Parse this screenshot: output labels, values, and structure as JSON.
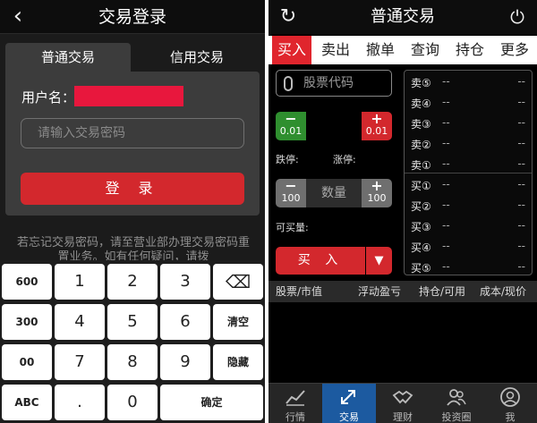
{
  "login_screen": {
    "title": "交易登录",
    "tabs": [
      {
        "label": "普通交易",
        "active": true
      },
      {
        "label": "信用交易",
        "active": false
      }
    ],
    "username_label": "用户名：",
    "password_placeholder": "请输入交易密码",
    "login_button": "登 录",
    "hint": "若忘记交易密码，请至营业部办理交易密码重置业务。如有任何疑问，请拨"
  },
  "keyboard": {
    "keys": [
      {
        "label": "600",
        "type": "side"
      },
      {
        "label": "1",
        "type": "num"
      },
      {
        "label": "2",
        "type": "num"
      },
      {
        "label": "3",
        "type": "num"
      },
      {
        "label": "⌫",
        "type": "del"
      },
      {
        "label": "300",
        "type": "side"
      },
      {
        "label": "4",
        "type": "num"
      },
      {
        "label": "5",
        "type": "num"
      },
      {
        "label": "6",
        "type": "num"
      },
      {
        "label": "清空",
        "type": "side"
      },
      {
        "label": "00",
        "type": "side"
      },
      {
        "label": "7",
        "type": "num"
      },
      {
        "label": "8",
        "type": "num"
      },
      {
        "label": "9",
        "type": "num"
      },
      {
        "label": "隐藏",
        "type": "side"
      },
      {
        "label": "ABC",
        "type": "side"
      },
      {
        "label": ".",
        "type": "num"
      },
      {
        "label": "0",
        "type": "num"
      },
      {
        "label": "确定",
        "type": "side"
      }
    ]
  },
  "trade_screen": {
    "title": "普通交易",
    "tabs": [
      {
        "label": "买入",
        "active": true
      },
      {
        "label": "卖出",
        "active": false
      },
      {
        "label": "撤单",
        "active": false
      },
      {
        "label": "查询",
        "active": false
      },
      {
        "label": "持仓",
        "active": false
      },
      {
        "label": "更多",
        "active": false
      }
    ],
    "search_placeholder": "股票代码",
    "price_stepper": {
      "minus_value": "0.01",
      "plus_value": "0.01",
      "value": ""
    },
    "limit_down_label": "跌停:",
    "limit_up_label": "涨停:",
    "qty_stepper": {
      "minus_value": "100",
      "plus_value": "100",
      "placeholder": "数量"
    },
    "buyable_label": "可买量:",
    "buy_button": "买 入",
    "buy_dropdown": "▼",
    "order_book": [
      {
        "label": "卖⑤",
        "price": "--",
        "volume": "--"
      },
      {
        "label": "卖④",
        "price": "--",
        "volume": "--"
      },
      {
        "label": "卖③",
        "price": "--",
        "volume": "--"
      },
      {
        "label": "卖②",
        "price": "--",
        "volume": "--"
      },
      {
        "label": "卖①",
        "price": "--",
        "volume": "--"
      },
      {
        "label": "买①",
        "price": "--",
        "volume": "--"
      },
      {
        "label": "买②",
        "price": "--",
        "volume": "--"
      },
      {
        "label": "买③",
        "price": "--",
        "volume": "--"
      },
      {
        "label": "买④",
        "price": "--",
        "volume": "--"
      },
      {
        "label": "买⑤",
        "price": "--",
        "volume": "--"
      }
    ],
    "holdings_headers": [
      "股票/市值",
      "浮动盈亏",
      "持仓/可用",
      "成本/现价"
    ],
    "bottom_nav": [
      {
        "label": "行情",
        "icon": "chart-line-icon",
        "active": false
      },
      {
        "label": "交易",
        "icon": "exchange-arrows-icon",
        "active": true
      },
      {
        "label": "理财",
        "icon": "handshake-icon",
        "active": false
      },
      {
        "label": "投资圈",
        "icon": "people-icon",
        "active": false
      },
      {
        "label": "我",
        "icon": "user-icon",
        "active": false
      }
    ]
  },
  "colors": {
    "accent_red": "#d3282d",
    "price_green": "#2f8f2f",
    "nav_active_blue": "#1c5aa0"
  }
}
